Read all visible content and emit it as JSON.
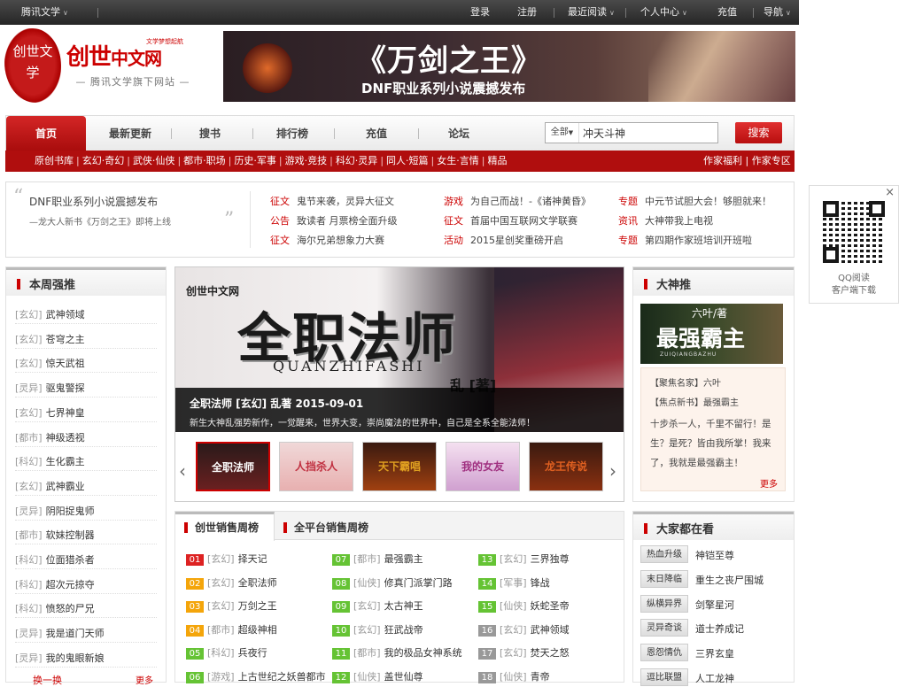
{
  "topbar": {
    "brand": "腾讯文学",
    "login": "登录",
    "register": "注册",
    "recent": "最近阅读",
    "personal": "个人中心",
    "recharge": "充值",
    "navigate": "导航"
  },
  "logo": {
    "seal": "创世文学",
    "name_a": "创世",
    "name_b": "中文网",
    "tag_top": "文学梦想起航",
    "slogan": "腾讯文学旗下网站"
  },
  "banner": {
    "title": "《万剑之王》",
    "subtitle": "DNF职业系列小说震撼发布"
  },
  "nav": {
    "tabs": [
      "首页",
      "最新更新",
      "搜书",
      "排行榜",
      "充值",
      "论坛"
    ],
    "search_scope": "全部",
    "search_value": "冲天斗神",
    "search_button": "搜索"
  },
  "subnav": {
    "links": [
      "原创书库",
      "玄幻·奇幻",
      "武侠·仙侠",
      "都市·职场",
      "历史·军事",
      "游戏·竞技",
      "科幻·灵异",
      "同人·短篇",
      "女生·言情",
      "精品"
    ],
    "right": [
      "作家福利",
      "作家专区"
    ]
  },
  "strip": {
    "quote_title": "DNF职业系列小说震撼发布",
    "quote_sub": "—龙大人新书《万剑之王》即将上线",
    "news": [
      [
        {
          "cat": "征文",
          "text": "鬼节来袭，灵异大征文"
        },
        {
          "cat": "游戏",
          "text": "为自己而战！-《诸神黄昏》"
        },
        {
          "cat": "专题",
          "text": "中元节试胆大会！够胆就来！"
        }
      ],
      [
        {
          "cat": "公告",
          "text": "致读者 月票榜全面升级"
        },
        {
          "cat": "征文",
          "text": "首届中国互联网文学联赛"
        },
        {
          "cat": "资讯",
          "text": "大神带我上电视"
        }
      ],
      [
        {
          "cat": "征文",
          "text": "海尔兄弟想象力大赛"
        },
        {
          "cat": "活动",
          "text": "2015星创奖重磅开启"
        },
        {
          "cat": "专题",
          "text": "第四期作家班培训开班啦"
        }
      ]
    ]
  },
  "qr": {
    "line1": "QQ阅读",
    "line2": "客户端下载",
    "close": "×"
  },
  "weekly": {
    "title": "本周强推",
    "items": [
      {
        "g": "[玄幻]",
        "t": "武神领域"
      },
      {
        "g": "[玄幻]",
        "t": "苍穹之主"
      },
      {
        "g": "[玄幻]",
        "t": "惊天武祖"
      },
      {
        "g": "[灵异]",
        "t": "驱鬼警探"
      },
      {
        "g": "[玄幻]",
        "t": "七界神皇"
      },
      {
        "g": "[都市]",
        "t": "神级透视"
      },
      {
        "g": "[科幻]",
        "t": "生化霸主"
      },
      {
        "g": "[玄幻]",
        "t": "武神霸业"
      },
      {
        "g": "[灵异]",
        "t": "阴阳捉鬼师"
      },
      {
        "g": "[都市]",
        "t": "软妹控制器"
      },
      {
        "g": "[科幻]",
        "t": "位面猎杀者"
      },
      {
        "g": "[科幻]",
        "t": "超次元掠夺"
      },
      {
        "g": "[科幻]",
        "t": "愤怒的尸兄"
      },
      {
        "g": "[灵异]",
        "t": "我是道门天师"
      },
      {
        "g": "[灵异]",
        "t": "我的鬼眼新娘"
      }
    ],
    "footer_left": "换一换",
    "footer_right": "更多"
  },
  "feature": {
    "cover_brand": "创世中文网",
    "cover_title": "全职法师",
    "cover_pinyin": "QUANZHIFASHI",
    "cover_author": "乱 [著]",
    "headline": "全职法师 [玄幻] 乱著 2015-09-01",
    "desc": "新生大神乱强势新作，一觉醒来，世界大变，崇尚魔法的世界中，自己是全系全能法师！",
    "thumbs": [
      "全职法师",
      "人挡杀人",
      "天下霸唱",
      "我的女友",
      "龙王传说"
    ],
    "prev": "‹",
    "next": "›"
  },
  "dashen": {
    "title": "大神推",
    "cover_author": "六叶/著",
    "cover_title": "最强霸主",
    "cover_pinyin": "ZUIQIANGBAZHU",
    "label1": "【聚焦名家】六叶",
    "label2": "【焦点新书】最强霸主",
    "desc": "十步杀一人，千里不留行！是生？是死？皆由我所掌！我来了，我就是最强霸主！",
    "more": "更多"
  },
  "rank": {
    "tab_active": "创世销售周榜",
    "tab_other": "全平台销售周榜",
    "cols": [
      [
        {
          "n": "01",
          "g": "[玄幻]",
          "t": "择天记"
        },
        {
          "n": "02",
          "g": "[玄幻]",
          "t": "全职法师"
        },
        {
          "n": "03",
          "g": "[玄幻]",
          "t": "万剑之王"
        },
        {
          "n": "04",
          "g": "[都市]",
          "t": "超级神相"
        },
        {
          "n": "05",
          "g": "[科幻]",
          "t": "兵夜行"
        },
        {
          "n": "06",
          "g": "[游戏]",
          "t": "上古世纪之妖兽都市"
        }
      ],
      [
        {
          "n": "07",
          "g": "[都市]",
          "t": "最强霸主"
        },
        {
          "n": "08",
          "g": "[仙侠]",
          "t": "修真门派掌门路"
        },
        {
          "n": "09",
          "g": "[玄幻]",
          "t": "太古神王"
        },
        {
          "n": "10",
          "g": "[玄幻]",
          "t": "狂武战帝"
        },
        {
          "n": "11",
          "g": "[都市]",
          "t": "我的极品女神系统"
        },
        {
          "n": "12",
          "g": "[仙侠]",
          "t": "盖世仙尊"
        }
      ],
      [
        {
          "n": "13",
          "g": "[玄幻]",
          "t": "三界独尊"
        },
        {
          "n": "14",
          "g": "[军事]",
          "t": "锋战"
        },
        {
          "n": "15",
          "g": "[仙侠]",
          "t": "妖蛇圣帝"
        },
        {
          "n": "16",
          "g": "[玄幻]",
          "t": "武神领域"
        },
        {
          "n": "17",
          "g": "[玄幻]",
          "t": "焚天之怒"
        },
        {
          "n": "18",
          "g": "[仙侠]",
          "t": "青帝"
        }
      ]
    ]
  },
  "watching": {
    "title": "大家都在看",
    "items": [
      {
        "tag": "热血升级",
        "t": "神铠至尊"
      },
      {
        "tag": "末日降临",
        "t": "重生之丧尸围城"
      },
      {
        "tag": "纵横异界",
        "t": "剑擎星河"
      },
      {
        "tag": "灵异奇谈",
        "t": "道士养成记"
      },
      {
        "tag": "恩怨情仇",
        "t": "三界玄皇"
      },
      {
        "tag": "逗比联盟",
        "t": "人工龙神"
      }
    ]
  },
  "colors": {
    "red": "#c00",
    "dark_red": "#a80c0c",
    "rank_hot": "#d22",
    "rank_warm": "#f4a50a",
    "rank_norm": "#65c334",
    "rank_grey": "#999"
  }
}
